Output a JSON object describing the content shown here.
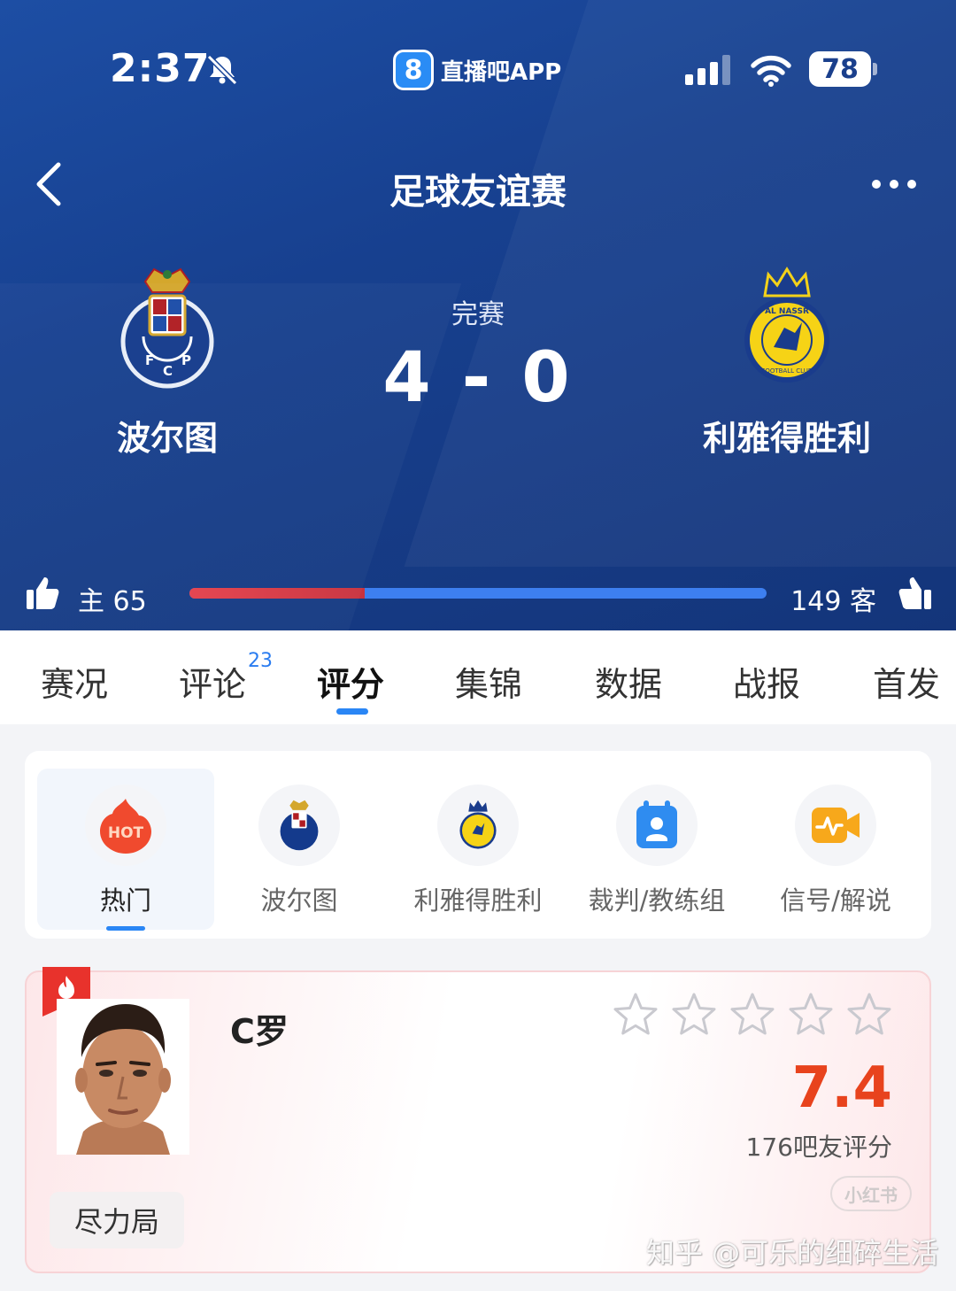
{
  "status_bar": {
    "time": "2:37",
    "battery": "78",
    "app_badge": "直播吧APP",
    "app_logo_char": "8"
  },
  "nav": {
    "title": "足球友谊赛"
  },
  "match": {
    "status": "完赛",
    "score": "4 - 0",
    "home": {
      "name": "波尔图"
    },
    "away": {
      "name": "利雅得胜利"
    }
  },
  "votes": {
    "home_text": "主 65",
    "away_text": "149 客",
    "home_votes": 65,
    "away_votes": 149,
    "home_color": "#e5414d",
    "away_color": "#3d7ff0"
  },
  "tabs": [
    {
      "label": "赛况"
    },
    {
      "label": "评论",
      "badge": "23"
    },
    {
      "label": "评分",
      "active": true
    },
    {
      "label": "集锦"
    },
    {
      "label": "数据"
    },
    {
      "label": "战报"
    },
    {
      "label": "首发"
    }
  ],
  "categories": [
    {
      "label": "热门",
      "icon": "hot-icon",
      "icon_text": "HOT",
      "active": true
    },
    {
      "label": "波尔图",
      "icon": "porto-crest-icon"
    },
    {
      "label": "利雅得胜利",
      "icon": "al-nassr-crest-icon"
    },
    {
      "label": "裁判/教练组",
      "icon": "referee-badge-icon"
    },
    {
      "label": "信号/解说",
      "icon": "video-signal-icon"
    }
  ],
  "player_rating": {
    "name": "C罗",
    "rating": "7.4",
    "rating_count": "176吧友评分",
    "stars_filled": 0,
    "stars_total": 5,
    "comment": "尽力局",
    "accent_color": "#e8431d"
  },
  "watermarks": {
    "xhs": "小红书",
    "zhihu": "知乎 @可乐的细碎生活"
  }
}
